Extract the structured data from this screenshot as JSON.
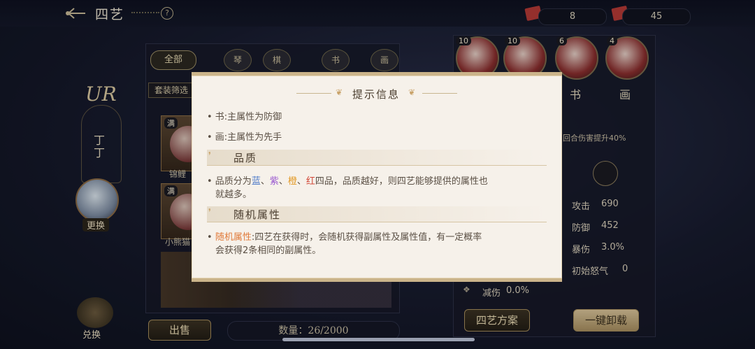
{
  "header": {
    "title": "四艺",
    "help_icon": "?"
  },
  "resources": [
    {
      "icon": "scroll-red-icon",
      "value": "8"
    },
    {
      "icon": "scroll-red-icon",
      "value": "45"
    }
  ],
  "filter_tabs": {
    "all": "全部",
    "items": [
      "琴",
      "棋",
      "书",
      "画"
    ]
  },
  "filter_dropdown": "套装筛选",
  "side": {
    "rarity": "UR",
    "name": "丁丁",
    "change_label": "更换",
    "exchange_label": "兑换"
  },
  "cards": [
    {
      "badge": "满",
      "name": "锦鲤"
    },
    {
      "badge": "满",
      "name": "小熊猫"
    }
  ],
  "bottom": {
    "sell_label": "出售",
    "count_label": "数量：26/2000"
  },
  "equipped": [
    {
      "level": "10",
      "label": ""
    },
    {
      "level": "10",
      "label": ""
    },
    {
      "level": "6",
      "label": "书"
    },
    {
      "level": "4",
      "label": "画"
    }
  ],
  "effect_text": "回合伤害提升40%",
  "stats": [
    {
      "name": "攻击",
      "value": "690"
    },
    {
      "name": "防御",
      "value": "452"
    },
    {
      "name": "暴伤",
      "value": "3.0%"
    },
    {
      "name": "初始怒气",
      "value": "0"
    },
    {
      "name": "减伤",
      "value": "0.0%"
    }
  ],
  "right_buttons": {
    "plan": "四艺方案",
    "unequip": "一键卸载"
  },
  "modal": {
    "title": "提示信息",
    "lines_top": [
      "• 书:主属性为防御",
      "• 画:主属性为先手"
    ],
    "section1": {
      "title": "品质",
      "prefix": "• 品质分为",
      "q1": "蓝",
      "sep": "、",
      "q2": "紫",
      "q3": "橙",
      "q4": "红",
      "suffix": "四品，品质越好，则四艺能够提供的属性也",
      "line2": "就越多。"
    },
    "section2": {
      "title": "随机属性",
      "highlight": "随机属性",
      "text1": ":四艺在获得时，会随机获得副属性及属性值，有一定概率",
      "text2": "会获得2条相同的副属性。"
    }
  },
  "colors": {
    "modal_bg": "#f6f1ea",
    "accent_gold": "#cbb48a",
    "blue": "#4a78c8",
    "purple": "#9b5ad0",
    "orange": "#e39a26",
    "red": "#d24a3a"
  }
}
